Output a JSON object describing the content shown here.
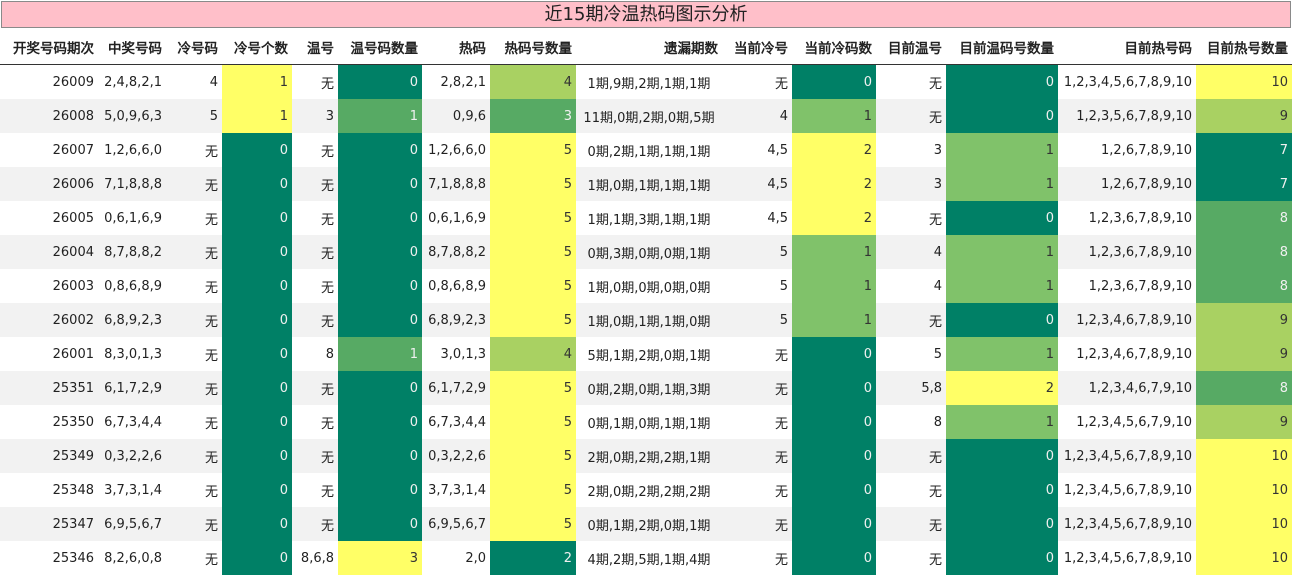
{
  "title": "近15期冷温热码图示分析",
  "headers": [
    "开奖号码期次",
    "中奖号码",
    "冷号码",
    "冷号个数",
    "温号",
    "温号码数量",
    "热码",
    "热码号数量",
    "遗漏期数",
    "当前冷号",
    "当前冷码数",
    "目前温号",
    "目前温码号数量",
    "目前热号码",
    "目前热号数量"
  ],
  "colors": {
    "yellow": "#ffff66",
    "light_green": "#a9d162",
    "green": "#80c26a",
    "mid_green": "#57aa64",
    "dark_green": "#008066",
    "title_bg": "#ffbfc9"
  },
  "rows": [
    [
      "26009",
      "2,4,8,2,1",
      "4",
      "1",
      "无",
      "0",
      "2,8,2,1",
      "4",
      "1期,9期,2期,1期,1期",
      "无",
      "0",
      "无",
      "0",
      "1,2,3,4,5,6,7,8,9,10",
      "10"
    ],
    [
      "26008",
      "5,0,9,6,3",
      "5",
      "1",
      "3",
      "1",
      "0,9,6",
      "3",
      "11期,0期,2期,0期,5期",
      "4",
      "1",
      "无",
      "0",
      "1,2,3,5,6,7,8,9,10",
      "9"
    ],
    [
      "26007",
      "1,2,6,6,0",
      "无",
      "0",
      "无",
      "0",
      "1,2,6,6,0",
      "5",
      "0期,2期,1期,1期,1期",
      "4,5",
      "2",
      "3",
      "1",
      "1,2,6,7,8,9,10",
      "7"
    ],
    [
      "26006",
      "7,1,8,8,8",
      "无",
      "0",
      "无",
      "0",
      "7,1,8,8,8",
      "5",
      "1期,0期,1期,1期,1期",
      "4,5",
      "2",
      "3",
      "1",
      "1,2,6,7,8,9,10",
      "7"
    ],
    [
      "26005",
      "0,6,1,6,9",
      "无",
      "0",
      "无",
      "0",
      "0,6,1,6,9",
      "5",
      "1期,1期,3期,1期,1期",
      "4,5",
      "2",
      "无",
      "0",
      "1,2,3,6,7,8,9,10",
      "8"
    ],
    [
      "26004",
      "8,7,8,8,2",
      "无",
      "0",
      "无",
      "0",
      "8,7,8,8,2",
      "5",
      "0期,3期,0期,0期,1期",
      "5",
      "1",
      "4",
      "1",
      "1,2,3,6,7,8,9,10",
      "8"
    ],
    [
      "26003",
      "0,8,6,8,9",
      "无",
      "0",
      "无",
      "0",
      "0,8,6,8,9",
      "5",
      "1期,0期,0期,0期,0期",
      "5",
      "1",
      "4",
      "1",
      "1,2,3,6,7,8,9,10",
      "8"
    ],
    [
      "26002",
      "6,8,9,2,3",
      "无",
      "0",
      "无",
      "0",
      "6,8,9,2,3",
      "5",
      "1期,0期,1期,1期,0期",
      "5",
      "1",
      "无",
      "0",
      "1,2,3,4,6,7,8,9,10",
      "9"
    ],
    [
      "26001",
      "8,3,0,1,3",
      "无",
      "0",
      "8",
      "1",
      "3,0,1,3",
      "4",
      "5期,1期,2期,0期,1期",
      "无",
      "0",
      "5",
      "1",
      "1,2,3,4,6,7,8,9,10",
      "9"
    ],
    [
      "25351",
      "6,1,7,2,9",
      "无",
      "0",
      "无",
      "0",
      "6,1,7,2,9",
      "5",
      "0期,2期,0期,1期,3期",
      "无",
      "0",
      "5,8",
      "2",
      "1,2,3,4,6,7,9,10",
      "8"
    ],
    [
      "25350",
      "6,7,3,4,4",
      "无",
      "0",
      "无",
      "0",
      "6,7,3,4,4",
      "5",
      "0期,1期,0期,1期,1期",
      "无",
      "0",
      "8",
      "1",
      "1,2,3,4,5,6,7,9,10",
      "9"
    ],
    [
      "25349",
      "0,3,2,2,6",
      "无",
      "0",
      "无",
      "0",
      "0,3,2,2,6",
      "5",
      "2期,0期,2期,2期,1期",
      "无",
      "0",
      "无",
      "0",
      "1,2,3,4,5,6,7,8,9,10",
      "10"
    ],
    [
      "25348",
      "3,7,3,1,4",
      "无",
      "0",
      "无",
      "0",
      "3,7,3,1,4",
      "5",
      "2期,0期,2期,2期,2期",
      "无",
      "0",
      "无",
      "0",
      "1,2,3,4,5,6,7,8,9,10",
      "10"
    ],
    [
      "25347",
      "6,9,5,6,7",
      "无",
      "0",
      "无",
      "0",
      "6,9,5,6,7",
      "5",
      "0期,1期,2期,0期,1期",
      "无",
      "0",
      "无",
      "0",
      "1,2,3,4,5,6,7,8,9,10",
      "10"
    ],
    [
      "25346",
      "8,2,6,0,8",
      "无",
      "0",
      "8,6,8",
      "3",
      "2,0",
      "2",
      "4期,2期,5期,1期,4期",
      "无",
      "0",
      "无",
      "0",
      "1,2,3,4,5,6,7,8,9,10",
      "10"
    ]
  ]
}
